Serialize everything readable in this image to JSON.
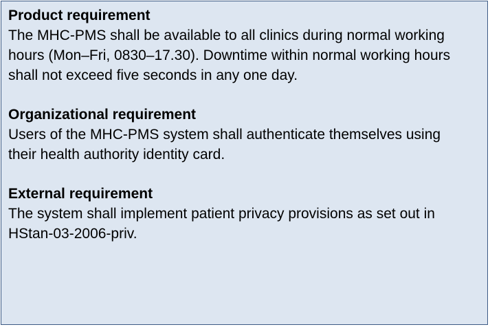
{
  "sections": [
    {
      "heading": "Product requirement",
      "lines": [
        "The MHC-PMS shall be available to all clinics during normal working",
        "hours (Mon–Fri, 0830–17.30). Downtime within normal working hours",
        "shall not exceed five seconds in any one day."
      ]
    },
    {
      "heading": "Organizational requirement",
      "lines": [
        "Users of the MHC-PMS system shall authenticate themselves using",
        "their health authority identity card."
      ]
    },
    {
      "heading": "External requirement",
      "lines": [
        "The system shall implement patient privacy provisions as set out in",
        "HStan-03-2006-priv."
      ]
    }
  ]
}
